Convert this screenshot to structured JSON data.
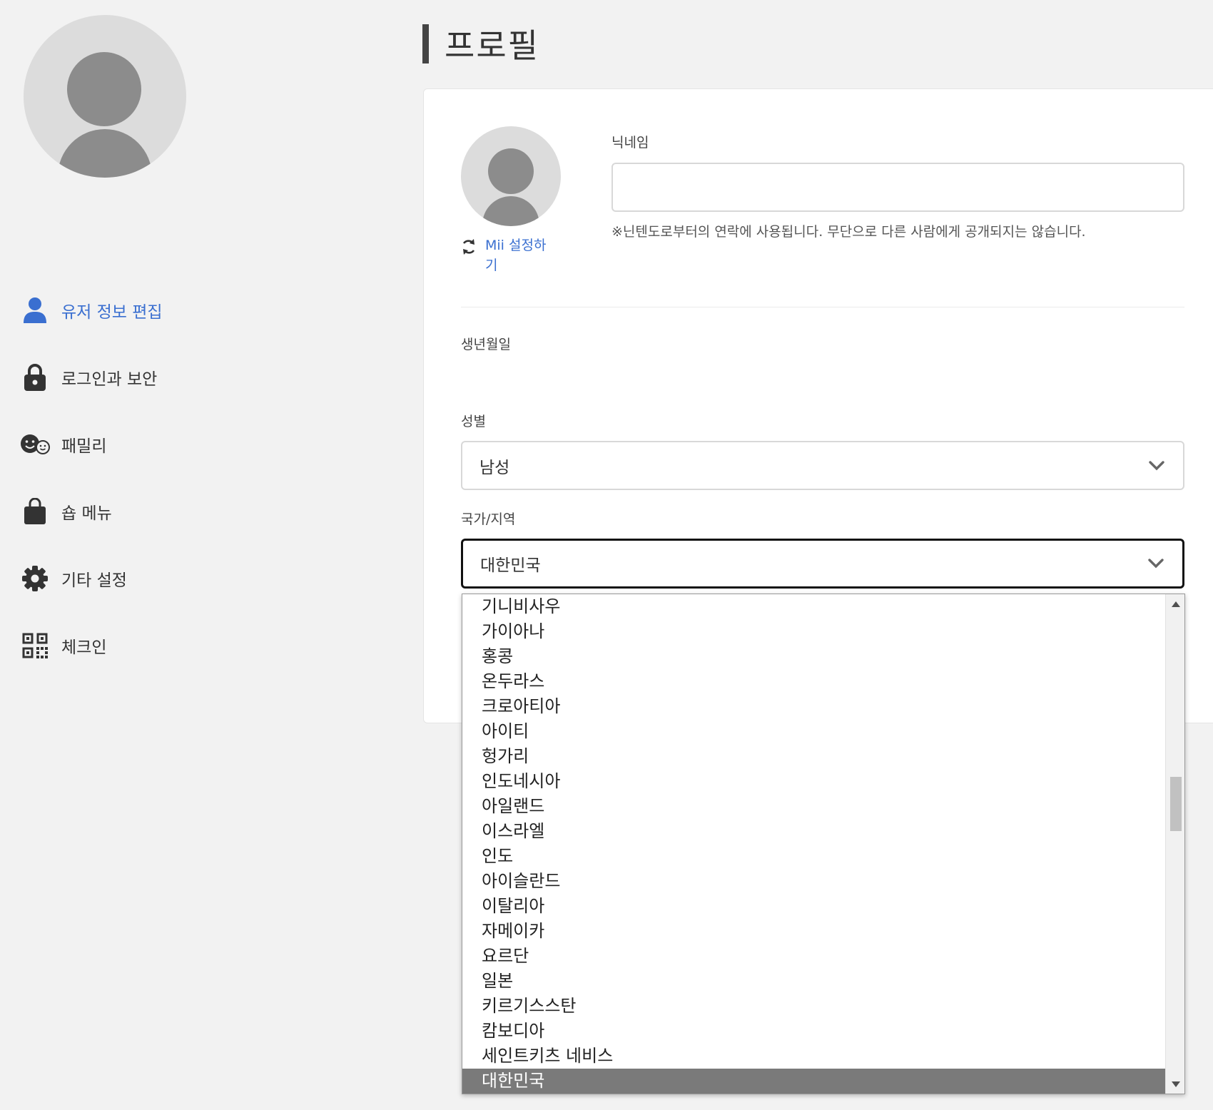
{
  "sidebar": {
    "items": [
      {
        "label": "유저 정보 편집",
        "icon": "user-icon",
        "active": true
      },
      {
        "label": "로그인과 보안",
        "icon": "lock-icon"
      },
      {
        "label": "패밀리",
        "icon": "family-icon"
      },
      {
        "label": "숍 메뉴",
        "icon": "shopping-bag-icon"
      },
      {
        "label": "기타 설정",
        "icon": "gear-icon"
      },
      {
        "label": "체크인",
        "icon": "qr-code-icon"
      }
    ]
  },
  "page": {
    "title": "프로필"
  },
  "profile": {
    "mii_link": "Mii 설정하기",
    "nickname_label": "닉네임",
    "nickname_value": "",
    "nickname_hint": "※닌텐도로부터의 연락에 사용됩니다. 무단으로 다른 사람에게 공개되지는 않습니다.",
    "birthday_label": "생년월일",
    "gender_label": "성별",
    "gender_value": "남성",
    "country_label": "국가/지역",
    "country_value": "대한민국"
  },
  "country_dropdown": {
    "options": [
      "기니비사우",
      "가이아나",
      "홍콩",
      "온두라스",
      "크로아티아",
      "아이티",
      "헝가리",
      "인도네시아",
      "아일랜드",
      "이스라엘",
      "인도",
      "아이슬란드",
      "이탈리아",
      "자메이카",
      "요르단",
      "일본",
      "키르기스스탄",
      "캄보디아",
      "세인트키츠 네비스",
      "대한민국"
    ],
    "selected": "대한민국"
  },
  "colors": {
    "accent": "#3a6fd0",
    "background": "#f2f2f2",
    "avatar_bg": "#dcdcdc",
    "avatar_fg": "#8c8c8c",
    "selected_option": "#7a7a7a"
  }
}
